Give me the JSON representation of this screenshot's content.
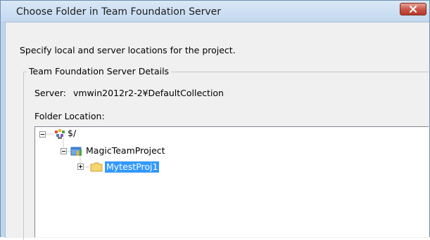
{
  "window": {
    "title": "Choose Folder in Team Foundation Server",
    "close_icon": "close-icon"
  },
  "dialog": {
    "description": "Specify local and server locations for the project.",
    "group_title": "Team Foundation Server Details",
    "server_label": "Server:",
    "server_value": "vmwin2012r2-2¥DefaultCollection",
    "folder_location_label": "Folder Location:"
  },
  "tree": {
    "nodes": [
      {
        "label": "$/",
        "expander": "minus",
        "icon": "tfs-server-icon",
        "selected": false
      },
      {
        "label": "MagicTeamProject",
        "expander": "minus",
        "icon": "team-project-icon",
        "selected": false
      },
      {
        "label": "MytestProj1",
        "expander": "plus",
        "icon": "folder-icon",
        "selected": true
      }
    ]
  },
  "colors": {
    "selection": "#3399ff",
    "title_bar": "#c3d8ef",
    "close_button": "#c75346"
  }
}
